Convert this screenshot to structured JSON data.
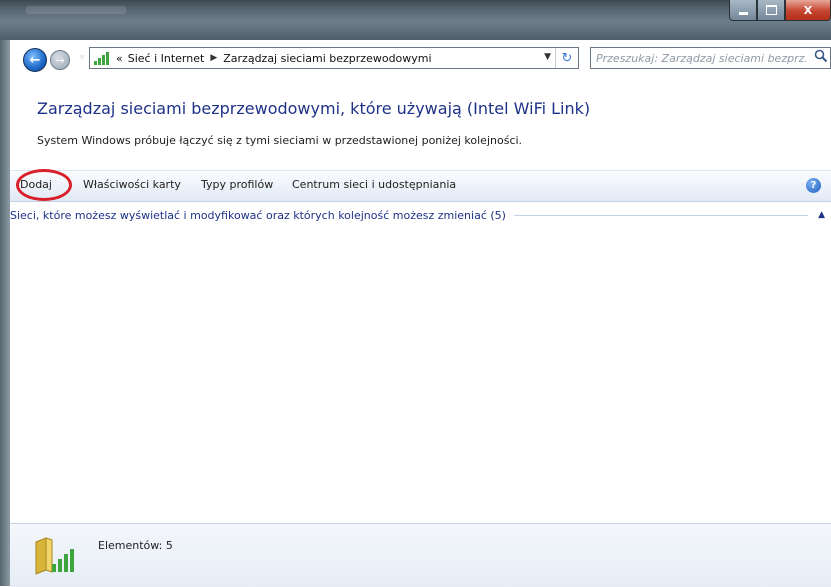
{
  "window": {
    "controls": {
      "minimize_icon": "minimize-icon",
      "maximize_icon": "maximize-icon",
      "close_label": "X"
    }
  },
  "navigation": {
    "breadcrumb": [
      "«",
      "Sieć i Internet",
      "Zarządzaj sieciami bezprzewodowymi"
    ],
    "search_placeholder": "Przeszukaj: Zarządzaj sieciami bezprz..."
  },
  "page": {
    "title": "Zarządzaj sieciami bezprzewodowymi, które używają (Intel WiFi Link)",
    "description": "System Windows próbuje łączyć się z tymi sieciami w przedstawionej poniżej kolejności."
  },
  "toolbar": {
    "add_label": "Dodaj",
    "adapter_properties_label": "Właściwości karty",
    "profile_types_label": "Typy profilów",
    "network_center_label": "Centrum sieci i udostępniania",
    "help_icon": "help-icon",
    "highlight_color": "#d8202a"
  },
  "network_group": {
    "label": "Sieci, które możesz wyświetlać i modyfikować oraz których kolejność możesz zmieniać (5)",
    "collapse_icon": "chevron-up-icon"
  },
  "details_pane": {
    "items_count_text": "Elementów: 5",
    "icon": "wireless-folder-icon"
  }
}
